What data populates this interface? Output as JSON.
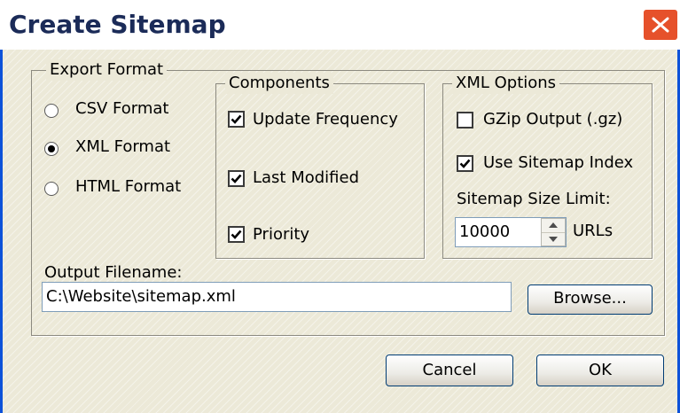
{
  "window": {
    "title": "Create Sitemap"
  },
  "export_format": {
    "legend": "Export Format",
    "options": [
      {
        "label": "CSV Format",
        "selected": false
      },
      {
        "label": "XML Format",
        "selected": true
      },
      {
        "label": "HTML Format",
        "selected": false
      }
    ]
  },
  "components": {
    "legend": "Components",
    "items": [
      {
        "label": "Update Frequency",
        "checked": true
      },
      {
        "label": "Last Modified",
        "checked": true
      },
      {
        "label": "Priority",
        "checked": true
      }
    ]
  },
  "xml_options": {
    "legend": "XML Options",
    "gzip_label": "GZip Output (.gz)",
    "gzip_checked": false,
    "index_label": "Use Sitemap Index",
    "index_checked": true,
    "size_limit_label": "Sitemap Size Limit:",
    "size_limit_value": "10000",
    "size_unit": "URLs"
  },
  "output": {
    "label": "Output Filename:",
    "value": "C:\\Website\\sitemap.xml",
    "browse_label": "Browse..."
  },
  "buttons": {
    "cancel": "Cancel",
    "ok": "OK"
  }
}
